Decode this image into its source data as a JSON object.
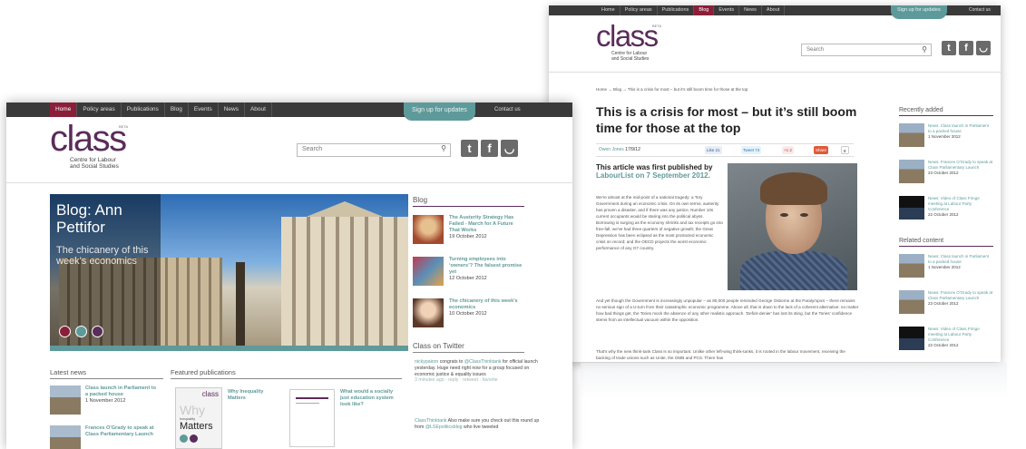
{
  "nav": {
    "items": [
      "Home",
      "Policy areas",
      "Publications",
      "Blog",
      "Events",
      "News",
      "About"
    ],
    "signup": "Sign up for updates",
    "contact": "Contact us"
  },
  "brand": {
    "logo": "class",
    "beta": "BETA",
    "tag1": "Centre for Labour",
    "tag2": "and Social Studies"
  },
  "search": {
    "placeholder": "Search"
  },
  "social": {
    "twitter": "t",
    "facebook": "f",
    "rss": "◡"
  },
  "colors": {
    "brand_purple": "#5a2c5a",
    "accent_teal": "#5f9a9a",
    "active_red": "#8a1f3a",
    "topbar": "#3a3a3a"
  },
  "home": {
    "hero": {
      "title": "Blog: Ann Pettifor",
      "subtitle": "The chicanery of this week's economics"
    },
    "blog_heading": "Blog",
    "blog": [
      {
        "title": "The Austerity Strategy Has Failed - March for A Future That Works",
        "date": "19 October 2012"
      },
      {
        "title": "Turning employees into ‘owners’? The falsest promise yet",
        "date": "12 October 2012"
      },
      {
        "title": "The chicanery of this week's economics",
        "date": "10 October 2012"
      }
    ],
    "twitter_heading": "Class on Twitter",
    "tweets": [
      {
        "handle": "nickypairon",
        "text": " congrats to ",
        "handle2": "@ClassThinktank",
        "text2": " for official launch yesterday. Huge need right now for a group focused on economic justice & equality issues",
        "meta": "3 minutes ago · reply · retweet · favorite"
      },
      {
        "handle": "ClassThinktank",
        "text": " Also make sure you check out this round up from ",
        "handle2": "@LSEpoliticsblog",
        "text2": " who live tweeted",
        "meta": ""
      }
    ],
    "news_heading": "Latest news",
    "news": [
      {
        "title": "Class launch in Parliament to a packed house",
        "date": "1 November 2012"
      },
      {
        "title": "Frances O'Grady to speak at Class Parliamentary Launch",
        "date": ""
      }
    ],
    "pubs_heading": "Featured publications",
    "pubs": [
      {
        "title": "Why Inequality Matters",
        "cover_word": "Why",
        "cover_small": "Inequality",
        "cover_big": "Matters",
        "cover_logo": "class"
      },
      {
        "title": "What would a socially just education system look like?"
      }
    ]
  },
  "article": {
    "breadcrumb": "Home → Blog → This is a crisis for most – but it's still boom time for those at the top",
    "title": "This is a crisis for most – but it’s still boom time for those at the top",
    "author": "Owen Jones",
    "date": "17/9/12",
    "share": {
      "like": "Like",
      "like_count": "21",
      "tweet": "Tweet",
      "tweet_count": "74",
      "plus": "+1",
      "plus_count": "2",
      "share": "Share",
      "share_count": "8"
    },
    "lead_text": "This article was first published by ",
    "lead_link": "LabourList on 7 September 2012.",
    "para1": "We're almost at the mid-point of a national tragedy: a Tory Government during an economic crisis. On its own terms, austerity has proven a disaster, and if there was any justice, Number 10s current occupants would be staring into the political abyss. Borrowing is surging as the economy shrinks and tax receipts go into free-fall; we've had three quarters of negative growth; the Great Depression has been eclipsed as the most protracted economic crisis on record; and the OECD projects the worst economic performance of any G7 country.",
    "para2": "And yet though the Government is increasingly unpopular – as 80,000 people reminded George Osborne at the Paralympics – there remains no serious sign of a U-turn from their catastrophic economic programme. Above all, that is down to the lack of a coherent alternative: no matter how bad things get, the Tories mock the absence of any other realistic approach. 'Deficit-denier' has lost its sting, but the Tories' confidence stems from an intellectual vacuum within the opposition.",
    "para3": "That's why the new think-tank Class is so important. Unlike other left-wing think-tanks, it is rooted in the labour movement, receiving the backing of trade unions such as Unite, the GMB and PCS. There has",
    "recent_heading": "Recently added",
    "recent": [
      {
        "title": "News: Class launch in Parliament to a packed house",
        "date": "1 November 2012"
      },
      {
        "title": "News: Frances O'Grady to speak at Class Parliamentary Launch",
        "date": "23 October 2012"
      },
      {
        "title": "News: Video of Class Fringe meeting at Labour Party Conference",
        "date": "22 October 2012"
      }
    ],
    "related_heading": "Related content",
    "related": [
      {
        "title": "News: Class launch in Parliament to a packed house",
        "date": "1 November 2012"
      },
      {
        "title": "News: Frances O'Grady to speak at Class Parliamentary Launch",
        "date": "23 October 2012"
      },
      {
        "title": "News: Video of Class Fringe meeting at Labour Party Conference",
        "date": "22 October 2012"
      }
    ]
  }
}
